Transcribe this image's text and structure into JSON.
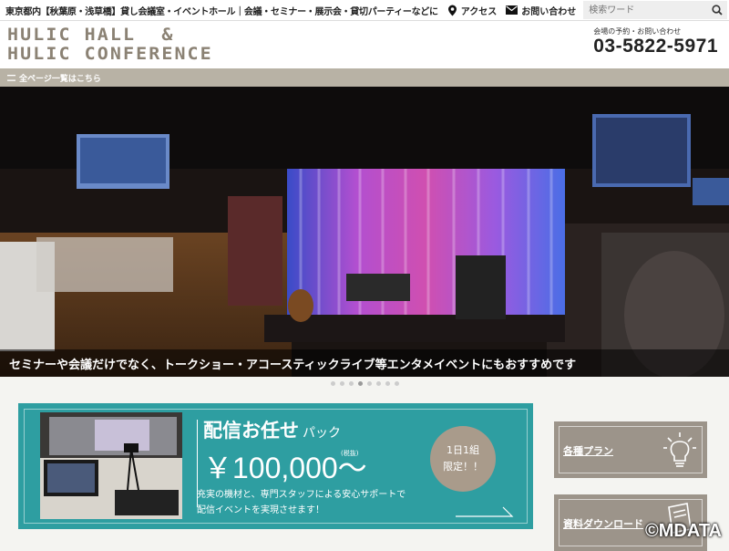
{
  "topbar": {
    "tagline": "東京都内【秋葉原・浅草橋】貸し会議室・イベントホール｜会議・セミナー・展示会・貸切パーティーなどに",
    "access_label": "アクセス",
    "contact_label": "お問い合わせ",
    "search_placeholder": "検索ワード"
  },
  "header": {
    "logo_line1": "HULIC HALL  &",
    "logo_line2": "HULIC CONFERENCE",
    "contact_label": "会場の予約・お問い合わせ",
    "phone": "03-5822-5971"
  },
  "navbar": {
    "all_pages_link": "全ページ一覧はこちら"
  },
  "hero": {
    "caption": "セミナーや会議だけでなく、トークショー・アコースティックライブ等エンタメイベントにもおすすめです",
    "slide_count": 8,
    "active_slide": 4
  },
  "banner": {
    "title": "配信お任せ",
    "title_suffix": "パック",
    "price": "￥100,000～",
    "tax_note": "(税抜)",
    "desc_line1": "充実の機材と、専門スタッフによる安心サポートで",
    "desc_line2": "配信イベントを実現させます！",
    "badge_line1": "1日1組",
    "badge_line2": "限定！！"
  },
  "sidebar": {
    "plans_label": "各種プラン",
    "download_label": "資料ダウンロード"
  },
  "watermark": "©MDATA",
  "colors": {
    "banner_bg": "#2e9ea1",
    "nav_bg": "#b8b2a5",
    "logo": "#8b8274",
    "side_button": "#9c948a",
    "badge": "#a99b8b"
  }
}
